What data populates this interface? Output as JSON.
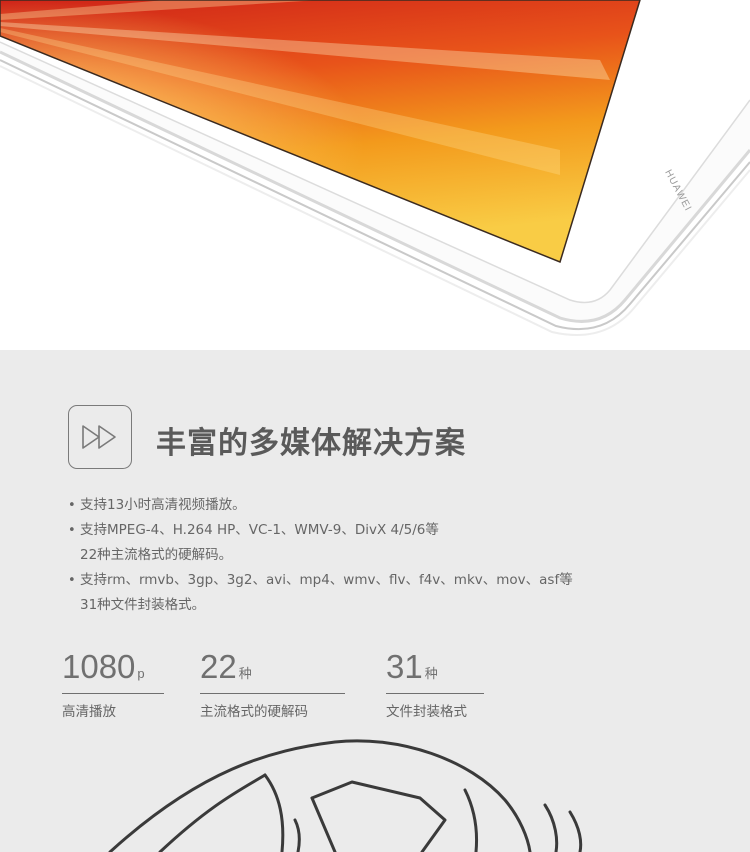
{
  "hero": {
    "brand": "HUAWEI"
  },
  "feature": {
    "icon": "fast-forward-icon",
    "title": "丰富的多媒体解决方案",
    "bullets": [
      {
        "dot": "•",
        "lines": [
          "支持13小时高清视频播放。"
        ]
      },
      {
        "dot": "•",
        "lines": [
          "支持MPEG-4、H.264 HP、VC-1、WMV-9、DivX 4/5/6等",
          "22种主流格式的硬解码。"
        ]
      },
      {
        "dot": "•",
        "lines": [
          "支持rm、rmvb、3gp、3g2、avi、mp4、wmv、flv、f4v、mkv、mov、asf等",
          "31种文件封装格式。"
        ]
      }
    ]
  },
  "stats": [
    {
      "value": "1080",
      "unit": "p",
      "label": "高清播放"
    },
    {
      "value": "22",
      "unit": "种",
      "label": "主流格式的硬解码"
    },
    {
      "value": "31",
      "unit": "种",
      "label": "文件封装格式"
    }
  ],
  "colors": {
    "section_bg": "#ebebeb",
    "screen_red": "#d42a1a",
    "screen_orange": "#f07a12",
    "screen_yellow": "#f8c43a",
    "text": "#5a5a5a"
  }
}
